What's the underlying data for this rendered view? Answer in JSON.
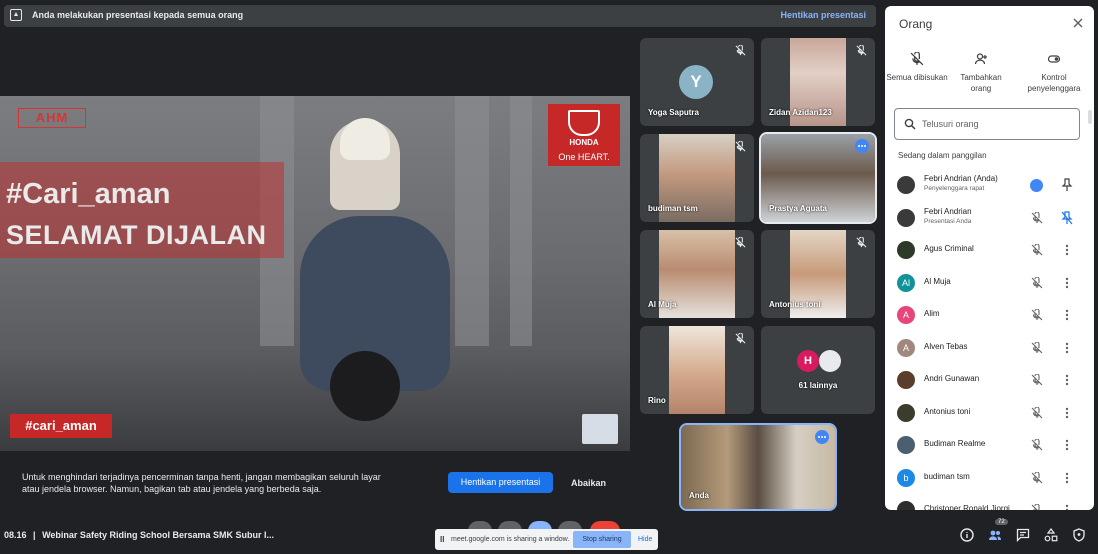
{
  "top_bar": {
    "message": "Anda melakukan presentasi kepada semua orang",
    "stop_label": "Hentikan presentasi"
  },
  "slide": {
    "logo_left": "AHM",
    "logo_brand": "HONDA",
    "logo_tag": "One HEART.",
    "headline_1": "#Cari_aman",
    "headline_2": "SELAMAT DIJALAN",
    "tag_badge": "#cari_aman"
  },
  "warning": {
    "text": "Untuk menghindari terjadinya pencerminan tanpa henti, jangan membagikan seluruh layar atau jendela browser. Namun, bagikan tab atau jendela yang berbeda saja.",
    "stop_label": "Hentikan presentasi",
    "ignore_label": "Abaikan"
  },
  "tiles": [
    {
      "name": "Yoga Saputra",
      "avatar": "Y",
      "avatar_color": "#8ab4c5"
    },
    {
      "name": "Zidan Azidan123"
    },
    {
      "name": "budiman tsm"
    },
    {
      "name": "Prastya Aguata"
    },
    {
      "name": "Al Muja"
    },
    {
      "name": "Antonius toni"
    },
    {
      "name": "Rino"
    },
    {
      "name": "61 lainnya",
      "avatar": "H",
      "avatar_color": "#d81b60"
    },
    {
      "name": "Anda"
    }
  ],
  "bottom": {
    "time": "08.16",
    "separator": "|",
    "meeting_title": "Webinar Safety Riding School Bersama SMK Subur I...",
    "share_text": "meet.google.com is sharing a window.",
    "share_pause": "II",
    "share_stop": "Stop sharing",
    "share_hide": "Hide",
    "people_count": "72"
  },
  "panel": {
    "title": "Orang",
    "actions": [
      {
        "label": "Semua dibisukan"
      },
      {
        "label": "Tambahkan orang"
      },
      {
        "label": "Kontrol penyelenggara"
      }
    ],
    "search_placeholder": "Telusuri orang",
    "section": "Sedang dalam panggilan",
    "people": [
      {
        "name": "Febri Andrian (Anda)",
        "sub": "Penyelenggara rapat",
        "avatar": "",
        "color": "#3a3a3a"
      },
      {
        "name": "Febri Andrian",
        "sub": "Presentasi Anda",
        "avatar": "",
        "color": "#3a3a3a"
      },
      {
        "name": "Agus Criminal",
        "avatar": "",
        "color": "#2d3a2a"
      },
      {
        "name": "Al Muja",
        "avatar": "Al",
        "color": "#12939a"
      },
      {
        "name": "Alim",
        "avatar": "A",
        "color": "#e8457a"
      },
      {
        "name": "Alven Tebas",
        "avatar": "A",
        "color": "#a1887f"
      },
      {
        "name": "Andri Gunawan",
        "avatar": "",
        "color": "#5a3e2b"
      },
      {
        "name": "Antonius toni",
        "avatar": "",
        "color": "#3b3b2e"
      },
      {
        "name": "Budiman Realme",
        "avatar": "",
        "color": "#4a6070"
      },
      {
        "name": "budiman tsm",
        "avatar": "b",
        "color": "#1e88e5"
      },
      {
        "name": "Christoper Ronald Jiorgi",
        "avatar": "",
        "color": "#2f2f2f"
      }
    ]
  },
  "colors": {
    "accent": "#1a73e8",
    "link": "#8ab4f8",
    "background": "#202124",
    "tile": "#3c4043"
  },
  "icons": [
    "present-icon",
    "mic-off-icon",
    "more-icon",
    "close-icon",
    "add-person-icon",
    "toggle-icon",
    "search-icon",
    "pin-icon",
    "info-icon",
    "people-icon",
    "chat-icon",
    "activities-icon",
    "shield-icon"
  ]
}
